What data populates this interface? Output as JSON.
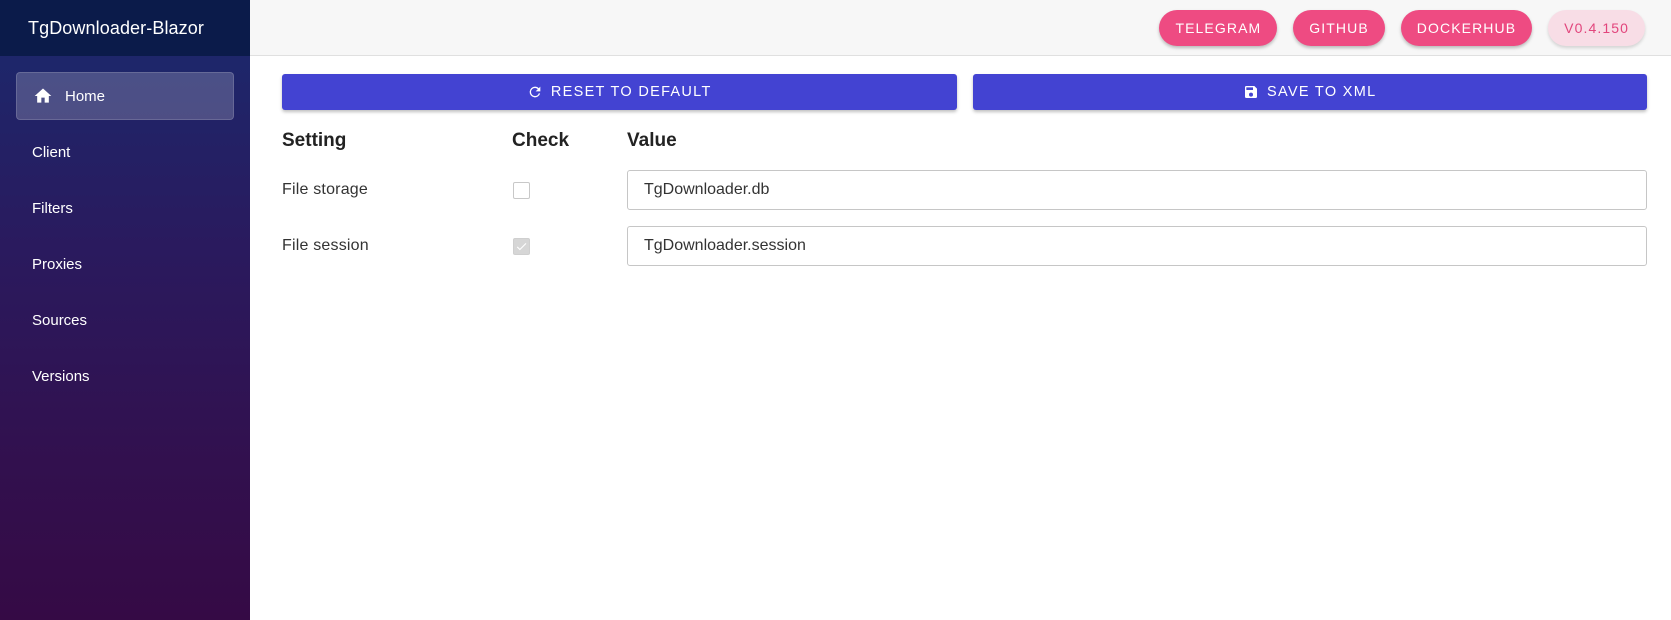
{
  "app": {
    "title": "TgDownloader-Blazor"
  },
  "sidebar": {
    "items": [
      {
        "label": "Home",
        "icon": "home-icon",
        "active": true
      },
      {
        "label": "Client"
      },
      {
        "label": "Filters"
      },
      {
        "label": "Proxies"
      },
      {
        "label": "Sources"
      },
      {
        "label": "Versions"
      }
    ]
  },
  "topbar": {
    "links": [
      "TELEGRAM",
      "GITHUB",
      "DOCKERHUB"
    ],
    "version": "V0.4.150"
  },
  "toolbar": {
    "reset_label": "RESET TO DEFAULT",
    "save_label": "SAVE TO XML"
  },
  "table": {
    "headers": [
      "Setting",
      "Check",
      "Value"
    ],
    "rows": [
      {
        "setting": "File storage",
        "checked": false,
        "value": "TgDownloader.db"
      },
      {
        "setting": "File session",
        "checked": true,
        "value": "TgDownloader.session"
      }
    ]
  },
  "colors": {
    "accent_pill": "#ee4b82",
    "primary_button": "#4343d2",
    "sidebar_top": "#1a2a6e",
    "sidebar_bottom": "#350a45"
  }
}
